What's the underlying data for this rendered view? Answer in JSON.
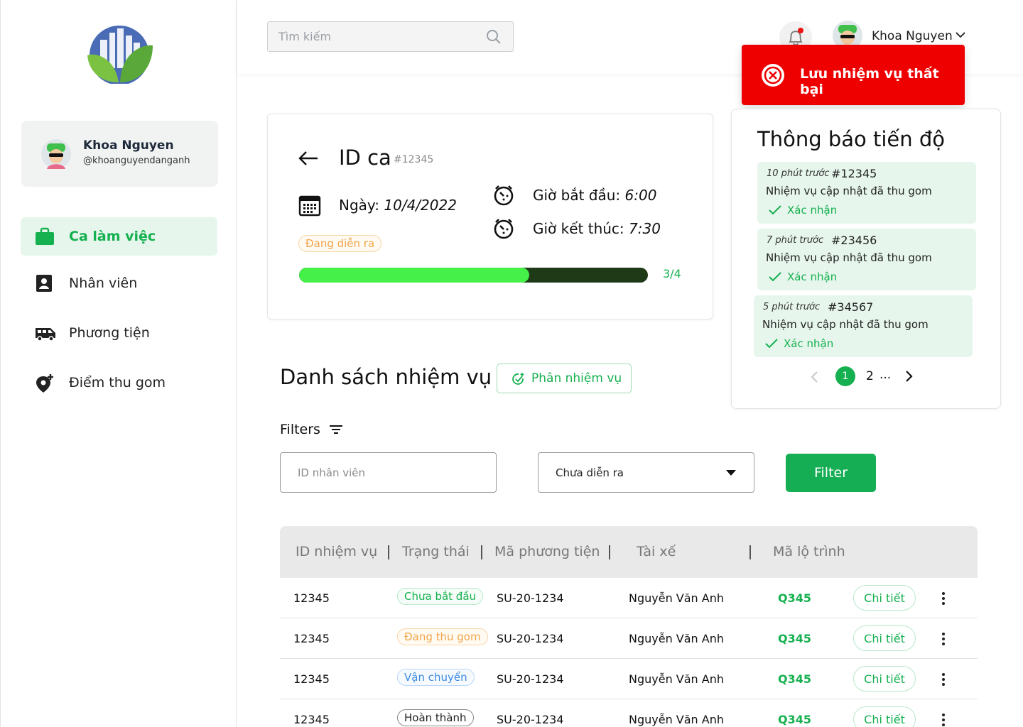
{
  "sidebar": {
    "profile": {
      "name": "Khoa Nguyen",
      "handle": "@khoanguyendanganh"
    },
    "items": [
      {
        "label": "Ca làm việc",
        "icon": "briefcase-icon",
        "active": true
      },
      {
        "label": "Nhân viên",
        "icon": "contact-card-icon",
        "active": false
      },
      {
        "label": "Phương tiện",
        "icon": "van-icon",
        "active": false
      },
      {
        "label": "Điểm thu gom",
        "icon": "location-add-icon",
        "active": false
      }
    ]
  },
  "header": {
    "search_placeholder": "Tìm kiếm",
    "user_name": "Khoa Nguyen"
  },
  "toast": {
    "message": "Lưu nhiệm vụ thất bại"
  },
  "shift": {
    "title": "ID ca",
    "id": "#12345",
    "date_prefix": "Ngày: ",
    "date": "10/4/2022",
    "start_prefix": "Giờ bắt đầu: ",
    "start": "6:00",
    "end_prefix": "Giờ kết thúc: ",
    "end": "7:30",
    "status": "Đang diễn ra",
    "progress_text": "3/4",
    "progress_fraction": 0.66
  },
  "notifications": {
    "title": "Thông báo tiến độ",
    "items": [
      {
        "time": "10 phút trước",
        "id": "#12345",
        "message": "Nhiệm vụ cập nhật đã thu gom",
        "confirm": "Xác nhận"
      },
      {
        "time": "7 phút trước",
        "id": "#23456",
        "message": "Nhiệm vụ cập nhật đã thu gom",
        "confirm": "Xác nhận"
      },
      {
        "time": "5 phút trước",
        "id": "#34567",
        "message": "Nhiệm vụ cập nhật đã thu gom",
        "confirm": "Xác nhận"
      }
    ],
    "pager": {
      "current": "1",
      "next": "2",
      "ellipsis": "..."
    }
  },
  "tasks": {
    "title": "Danh sách nhiệm vụ",
    "assign_label": "Phân nhiệm vụ",
    "filters_label": "Filters",
    "employee_id_placeholder": "ID nhân viên",
    "status_select": "Chưa diễn ra",
    "filter_button": "Filter",
    "columns": [
      "ID nhiệm vụ",
      "Trạng thái",
      "Mã phương tiện",
      "Tài xế",
      "Mã lộ trình"
    ],
    "rows": [
      {
        "id": "12345",
        "status": "Chưa bắt đầu",
        "status_color": "green",
        "vehicle": "SU-20-1234",
        "driver": "Nguyễn Văn Anh",
        "route": "Q345",
        "detail": "Chi tiết"
      },
      {
        "id": "12345",
        "status": "Đang thu gom",
        "status_color": "orange",
        "vehicle": "SU-20-1234",
        "driver": "Nguyễn Văn Anh",
        "route": "Q345",
        "detail": "Chi tiết"
      },
      {
        "id": "12345",
        "status": "Vận chuyển",
        "status_color": "blue",
        "vehicle": "SU-20-1234",
        "driver": "Nguyễn Văn Anh",
        "route": "Q345",
        "detail": "Chi tiết"
      },
      {
        "id": "12345",
        "status": "Hoàn thành",
        "status_color": "gray",
        "vehicle": "SU-20-1234",
        "driver": "Nguyễn Văn Anh",
        "route": "Q345",
        "detail": "Chi tiết"
      }
    ]
  },
  "colors": {
    "accent": "#15b04f",
    "toast_bg": "#ee0000",
    "progress_fill": "#45f048",
    "progress_track": "#1e3a17"
  }
}
